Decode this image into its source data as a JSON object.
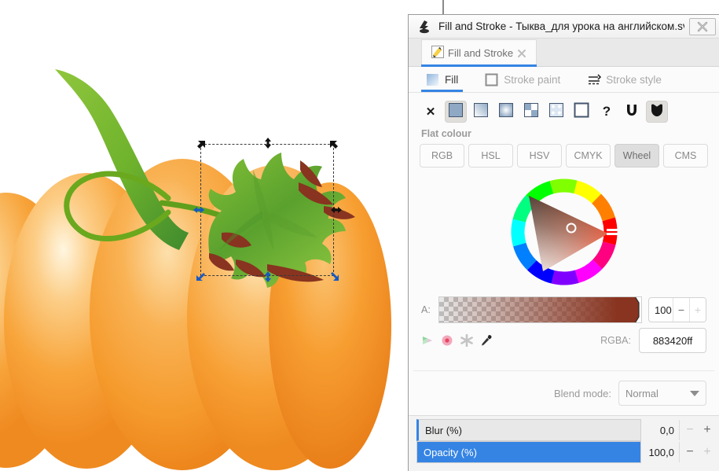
{
  "window": {
    "title": "Fill and Stroke - Тыква_для урока на английском.svg",
    "app_icon": "inkscape-icon",
    "close_label": "close-window"
  },
  "dock": {
    "tab_label": "Fill and Stroke",
    "tab_icon": "fill-and-stroke-icon",
    "tab_close_icon": "close-icon"
  },
  "fill_stroke_tabs": [
    {
      "label": "Fill",
      "icon": "fill-swatch-icon",
      "active": true
    },
    {
      "label": "Stroke paint",
      "icon": "stroke-paint-icon",
      "active": false
    },
    {
      "label": "Stroke style",
      "icon": "stroke-style-icon",
      "active": false
    }
  ],
  "paint_types": [
    {
      "name": "no-paint",
      "icon": "x-icon",
      "pressed": false
    },
    {
      "name": "flat-colour",
      "icon": "flat-colour-icon",
      "pressed": true
    },
    {
      "name": "linear-gradient",
      "icon": "linear-gradient-icon",
      "pressed": false
    },
    {
      "name": "radial-gradient",
      "icon": "radial-gradient-icon",
      "pressed": false
    },
    {
      "name": "pattern",
      "icon": "pattern-icon",
      "pressed": false
    },
    {
      "name": "swatch",
      "icon": "swatch-icon",
      "pressed": false
    },
    {
      "name": "unknown-paint",
      "icon": "unknown-paint-icon",
      "pressed": false
    },
    {
      "name": "unknown",
      "icon": "question-icon",
      "pressed": false
    },
    {
      "name": "unset-paint",
      "icon": "unset-paint-icon",
      "pressed": false
    },
    {
      "name": "set-paint",
      "icon": "set-paint-icon",
      "pressed": true
    }
  ],
  "paint_type_label": "Flat colour",
  "color_modes": [
    {
      "label": "RGB",
      "active": false
    },
    {
      "label": "HSL",
      "active": false
    },
    {
      "label": "HSV",
      "active": false
    },
    {
      "label": "CMYK",
      "active": false
    },
    {
      "label": "Wheel",
      "active": true
    },
    {
      "label": "CMS",
      "active": false
    }
  ],
  "wheel": {
    "marker_icon": "colour-marker-icon",
    "hue_handle_icon": "hue-handle-icon"
  },
  "alpha": {
    "label": "A:",
    "value": "100",
    "minus_label": "−",
    "plus_label": "+",
    "colour": "#883420"
  },
  "rgba": {
    "label": "RGBA:",
    "value": "883420ff",
    "tools": [
      {
        "name": "gradient-tool-icon"
      },
      {
        "name": "colour-target-icon"
      },
      {
        "name": "snowflake-icon"
      },
      {
        "name": "eyedropper-icon"
      }
    ]
  },
  "blend": {
    "label": "Blend mode:",
    "value": "Normal"
  },
  "sliders": [
    {
      "name": "blur",
      "label": "Blur (%)",
      "value": "0,0",
      "percent": 0,
      "minus_dim": true,
      "plus_dim": false
    },
    {
      "name": "opacity",
      "label": "Opacity (%)",
      "value": "100,0",
      "percent": 100,
      "minus_dim": false,
      "plus_dim": true
    }
  ],
  "canvas": {
    "artwork_name": "pumpkin-illustration",
    "selected_object": "leaf-object",
    "selection_handles": [
      "rotate-nw",
      "scale-n",
      "rotate-ne",
      "scale-w",
      "scale-e",
      "scale-sw",
      "scale-s",
      "scale-se"
    ],
    "colors": {
      "pumpkin_light": "#fbbd6a",
      "pumpkin_mid": "#f8992f",
      "pumpkin_dark": "#e8801e",
      "leaf_green_light": "#8cc63f",
      "leaf_green_dark": "#3f8a2e",
      "leaf_brown": "#883420",
      "stem_green": "#6aa81e"
    }
  }
}
